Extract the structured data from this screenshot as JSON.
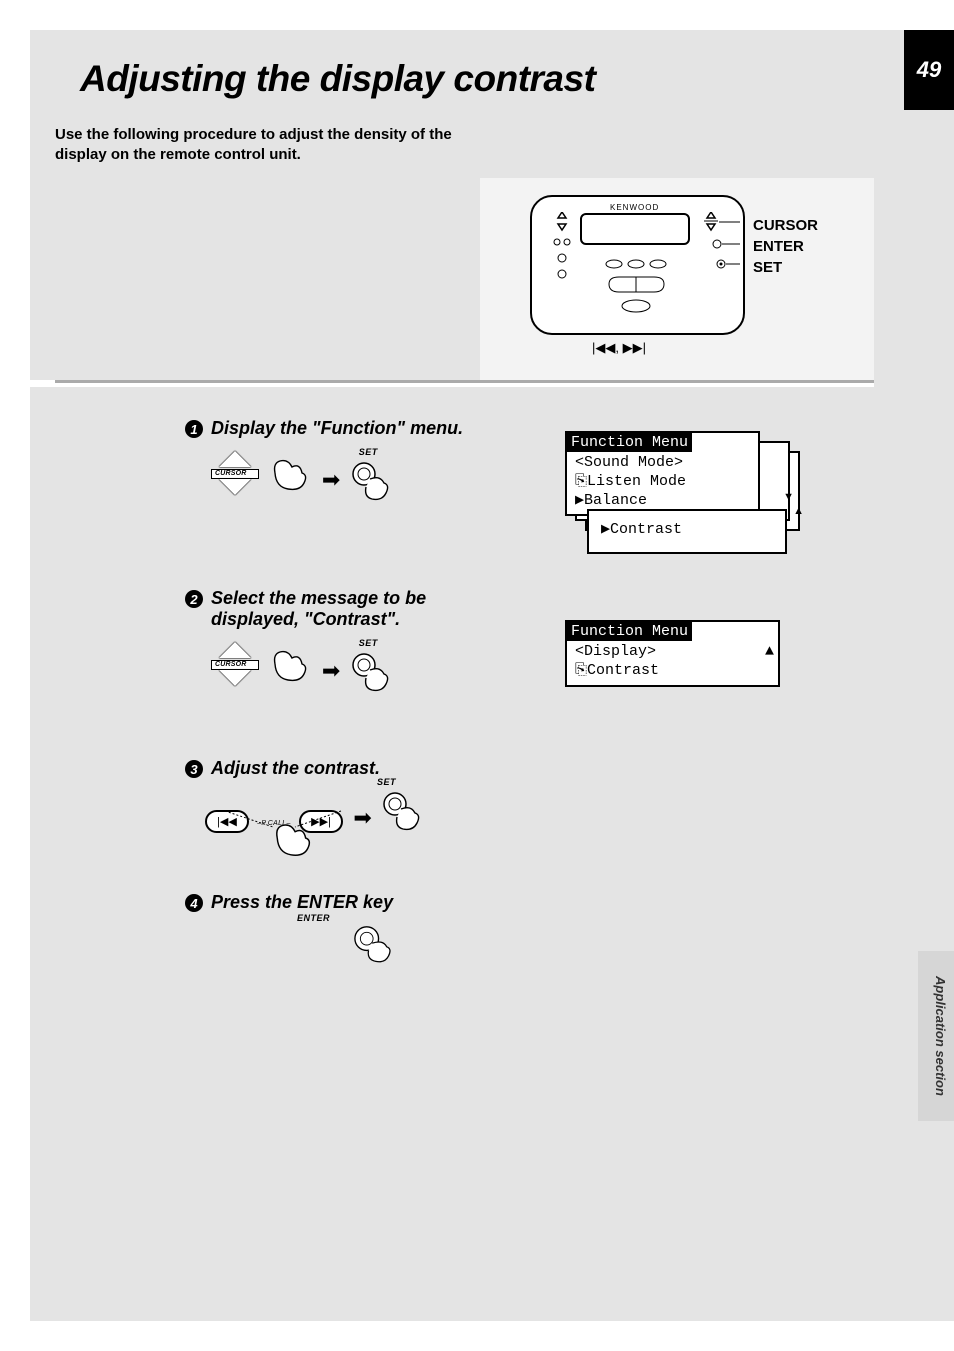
{
  "page_number": "49",
  "title": "Adjusting the display contrast",
  "intro": "Use the following procedure to adjust the density of the display on the remote control unit.",
  "remote": {
    "brand": "KENWOOD",
    "callout1": "CURSOR",
    "callout2": "ENTER",
    "callout3": "SET",
    "bottom_icons": "¢, 4 ›"
  },
  "sidebar_label": "Application section",
  "steps": [
    {
      "n": "1",
      "text": "Display the \"Function\" menu.",
      "btn1": "CURSOR",
      "btn2": "SET"
    },
    {
      "n": "2",
      "text": "Select the message to be displayed, \"Contrast\".",
      "btn1": "CURSOR",
      "btn2": "SET"
    },
    {
      "n": "3",
      "text": "Adjust the contrast.",
      "pill_left": "¢",
      "mid": "–P.CALL–",
      "pill_right": "›",
      "btn2": "SET"
    },
    {
      "n": "4",
      "text": "Press the ENTER key",
      "btn1": "ENTER"
    }
  ],
  "lcd1": {
    "title": "Function Menu",
    "line1": "<Sound Mode>",
    "line2": "⎘Listen Mode",
    "line3": "▶Balance",
    "contrast": "▶Contrast"
  },
  "lcd2": {
    "title": "Function Menu",
    "line1": "<Display>",
    "line2": "⎘Contrast"
  },
  "icons": {
    "prev": "⏮",
    "next": "⏭",
    "down_arrow": "▼",
    "up_arrow": "▲"
  }
}
